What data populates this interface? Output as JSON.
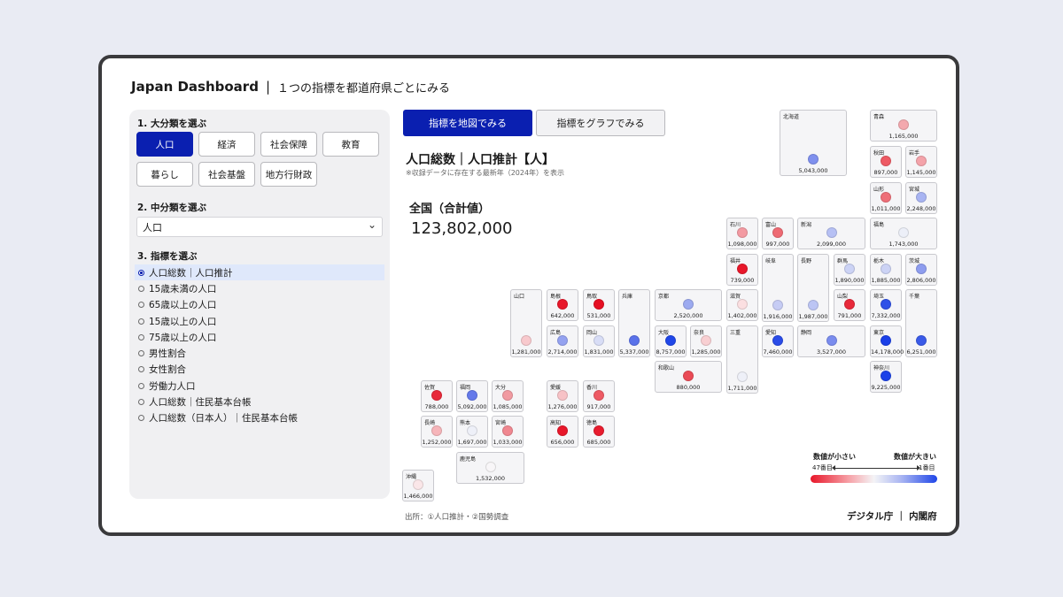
{
  "header": {
    "app_title": "Japan Dashboard",
    "separator": "|",
    "subtitle": "１つの指標を都道府県ごとにみる"
  },
  "sidebar": {
    "section1_label": "1. 大分類を選ぶ",
    "categories": [
      "人口",
      "経済",
      "社会保障",
      "教育",
      "暮らし",
      "社会基盤",
      "地方行財政"
    ],
    "selected_category": "人口",
    "section2_label": "2. 中分類を選ぶ",
    "subcategory_value": "人口",
    "section3_label": "3. 指標を選ぶ",
    "indicators": [
      "人口総数｜人口推計",
      "15歳未満の人口",
      "65歳以上の人口",
      "15歳以上の人口",
      "75歳以上の人口",
      "男性割合",
      "女性割合",
      "労働力人口",
      "人口総数｜住民基本台帳",
      "人口総数（日本人）｜住民基本台帳"
    ],
    "selected_indicator_index": 0
  },
  "tabs": {
    "map_label": "指標を地図でみる",
    "graph_label": "指標をグラフでみる"
  },
  "main": {
    "indicator_title": "人口総数｜人口推計【人】",
    "note": "※収録データに存在する最新年（2024年）を表示",
    "total_label": "全国（合計値）",
    "total_value": "123,802,000"
  },
  "prefectures": [
    {
      "name": "北海道",
      "value": "5,043,000",
      "color": "#7f90ee"
    },
    {
      "name": "青森",
      "value": "1,165,000",
      "color": "#f3a8ae"
    },
    {
      "name": "秋田",
      "value": "897,000",
      "color": "#ee5a64"
    },
    {
      "name": "岩手",
      "value": "1,145,000",
      "color": "#f4a3aa"
    },
    {
      "name": "山形",
      "value": "1,011,000",
      "color": "#ee6f78"
    },
    {
      "name": "宮城",
      "value": "2,248,000",
      "color": "#a8b4f2"
    },
    {
      "name": "石川",
      "value": "1,098,000",
      "color": "#f39aa2"
    },
    {
      "name": "富山",
      "value": "997,000",
      "color": "#ee6a73"
    },
    {
      "name": "新潟",
      "value": "2,099,000",
      "color": "#b6c0f4"
    },
    {
      "name": "福島",
      "value": "1,743,000",
      "color": "#eceff8"
    },
    {
      "name": "福井",
      "value": "739,000",
      "color": "#e8172a"
    },
    {
      "name": "岐阜",
      "value": "1,916,000",
      "color": "#c6ccf4"
    },
    {
      "name": "長野",
      "value": "1,987,000",
      "color": "#bcc5f4"
    },
    {
      "name": "群馬",
      "value": "1,890,000",
      "color": "#ccd3f5"
    },
    {
      "name": "栃木",
      "value": "1,885,000",
      "color": "#ccd3f5"
    },
    {
      "name": "茨城",
      "value": "2,806,000",
      "color": "#8e9def"
    },
    {
      "name": "山口",
      "value": "1,281,000",
      "color": "#f8c9cd"
    },
    {
      "name": "島根",
      "value": "642,000",
      "color": "#e8172a"
    },
    {
      "name": "鳥取",
      "value": "531,000",
      "color": "#e60f22"
    },
    {
      "name": "兵庫",
      "value": "5,337,000",
      "color": "#5a72ea"
    },
    {
      "name": "京都",
      "value": "2,520,000",
      "color": "#9caaf0"
    },
    {
      "name": "滋賀",
      "value": "1,402,000",
      "color": "#fbdfe1"
    },
    {
      "name": "山梨",
      "value": "791,000",
      "color": "#e8293a"
    },
    {
      "name": "埼玉",
      "value": "7,332,000",
      "color": "#2e50e8"
    },
    {
      "name": "千葉",
      "value": "6,251,000",
      "color": "#3a5ae8"
    },
    {
      "name": "広島",
      "value": "2,714,000",
      "color": "#94a2f0"
    },
    {
      "name": "岡山",
      "value": "1,831,000",
      "color": "#d8ddf6"
    },
    {
      "name": "大阪",
      "value": "8,757,000",
      "color": "#1f46e8"
    },
    {
      "name": "奈良",
      "value": "1,285,000",
      "color": "#f8cfd2"
    },
    {
      "name": "三重",
      "value": "1,711,000",
      "color": "#eef0f8"
    },
    {
      "name": "愛知",
      "value": "7,460,000",
      "color": "#2a4ce8"
    },
    {
      "name": "静岡",
      "value": "3,527,000",
      "color": "#7a8cee"
    },
    {
      "name": "東京",
      "value": "14,178,000",
      "color": "#1a3fe8"
    },
    {
      "name": "和歌山",
      "value": "880,000",
      "color": "#ea4a55"
    },
    {
      "name": "神奈川",
      "value": "9,225,000",
      "color": "#1c42e8"
    },
    {
      "name": "佐賀",
      "value": "788,000",
      "color": "#e8293a"
    },
    {
      "name": "福岡",
      "value": "5,092,000",
      "color": "#6479ea"
    },
    {
      "name": "大分",
      "value": "1,085,000",
      "color": "#f19aa1"
    },
    {
      "name": "愛媛",
      "value": "1,276,000",
      "color": "#f7c2c6"
    },
    {
      "name": "香川",
      "value": "917,000",
      "color": "#ee5a64"
    },
    {
      "name": "長崎",
      "value": "1,252,000",
      "color": "#f6b5ba"
    },
    {
      "name": "熊本",
      "value": "1,697,000",
      "color": "#eef0f8"
    },
    {
      "name": "宮崎",
      "value": "1,033,000",
      "color": "#f08790"
    },
    {
      "name": "高知",
      "value": "656,000",
      "color": "#e8172a"
    },
    {
      "name": "徳島",
      "value": "685,000",
      "color": "#e81c2e"
    },
    {
      "name": "鹿児島",
      "value": "1,532,000",
      "color": "#f8f6f8"
    },
    {
      "name": "沖縄",
      "value": "1,466,000",
      "color": "#fae6e8"
    }
  ],
  "legend": {
    "low_label": "数値が小さい",
    "high_label": "数値が大きい",
    "low_rank": "47番目",
    "high_rank": "1番目",
    "low_color": "#e8172a",
    "high_color": "#1f46e8"
  },
  "footer": {
    "source": "出所：①人口推計・②国勢調査",
    "org": "デジタル庁 ｜ 内閣府"
  }
}
